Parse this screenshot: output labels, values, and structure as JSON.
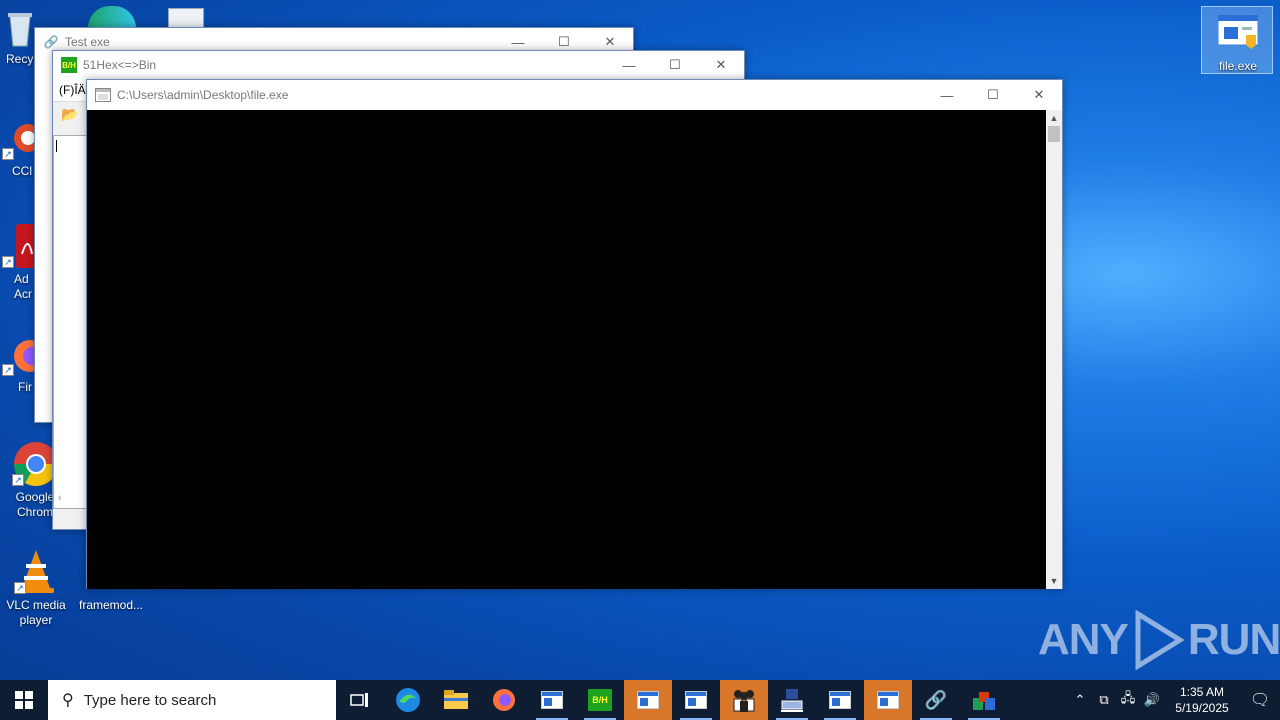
{
  "desktop": {
    "icons": [
      {
        "label": "Recy"
      },
      {
        "label": "CCl"
      },
      {
        "label": "Ad Acr"
      },
      {
        "label": "Fir"
      },
      {
        "label": "Google Chrom"
      },
      {
        "label": "VLC media player"
      },
      {
        "label": "framemod..."
      },
      {
        "label": "file.exe"
      }
    ]
  },
  "windows": {
    "test": {
      "title": "Test exe"
    },
    "hexbin": {
      "title": "51Hex<=>Bin",
      "menu_label": "(F)ÎÄ",
      "icon_text": "B/H"
    },
    "console": {
      "title": "C:\\Users\\admin\\Desktop\\file.exe"
    }
  },
  "controls": {
    "minimize": "—",
    "maximize": "☐",
    "close": "✕"
  },
  "taskbar": {
    "search_placeholder": "Type here to search",
    "time": "1:35 AM",
    "date": "5/19/2025"
  },
  "watermark": {
    "text_left": "ANY",
    "text_right": "RUN"
  },
  "colors": {
    "accent": "#d8762a",
    "taskbar": "#0f1d33",
    "console_bg": "#000000"
  }
}
